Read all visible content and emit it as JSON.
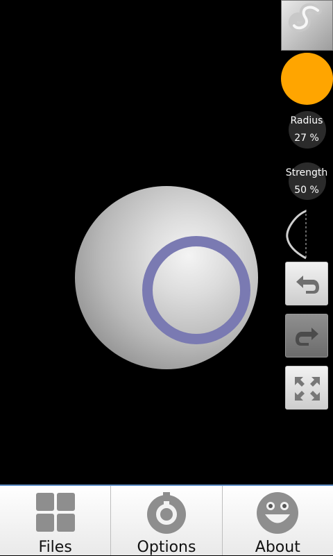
{
  "tools": {
    "brush_icon": "sculpt-brush-icon",
    "color": "#ffa500",
    "radius": {
      "label": "Radius",
      "value": "27 %"
    },
    "strength": {
      "label": "Strength",
      "value": "50 %"
    },
    "falloff_icon": "falloff-curve-icon"
  },
  "actions": {
    "undo_icon": "undo-arrow-icon",
    "redo_icon": "redo-arrow-icon",
    "fullscreen_icon": "expand-arrows-icon"
  },
  "brush_ring_color": "#7a7ab2",
  "accent_color": "#5e8fc7",
  "bottom_bar": {
    "tabs": [
      {
        "label": "Files",
        "icon": "grid-icon"
      },
      {
        "label": "Options",
        "icon": "settings-dial-icon"
      },
      {
        "label": "About",
        "icon": "smiley-icon"
      }
    ]
  }
}
